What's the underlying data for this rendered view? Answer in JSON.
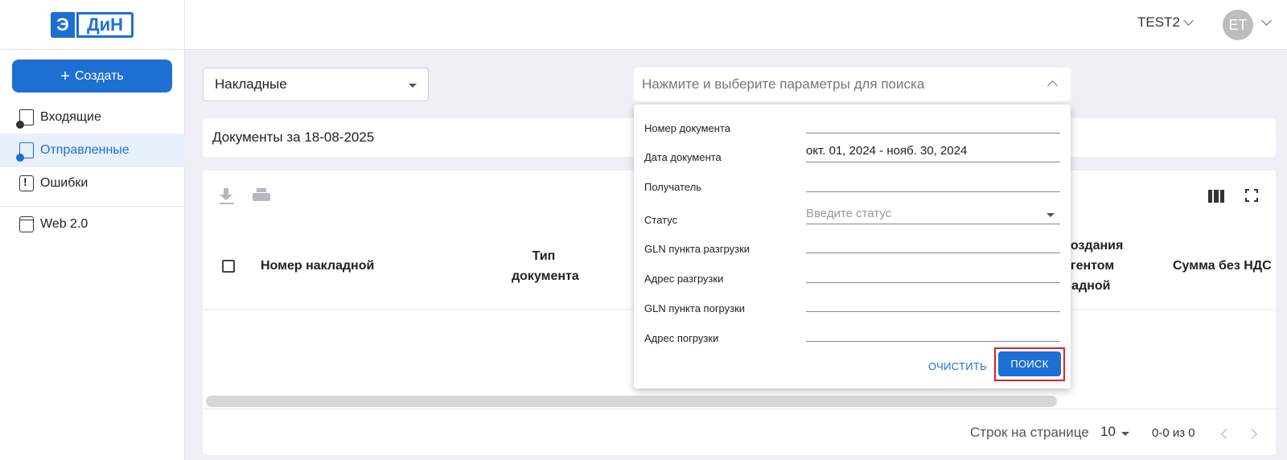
{
  "logo": {
    "left": "Э",
    "right": "ДиН"
  },
  "header": {
    "account": "TEST2",
    "avatar": "ET"
  },
  "sidebar": {
    "create_label": "Создать",
    "items": [
      {
        "label": "Входящие",
        "icon": "incoming-doc-icon"
      },
      {
        "label": "Отправленные",
        "icon": "sent-doc-icon",
        "active": true
      },
      {
        "label": "Ошибки",
        "icon": "clipboard-alert-icon"
      },
      {
        "label": "Web 2.0",
        "icon": "window-icon"
      }
    ]
  },
  "main": {
    "doc_type": "Накладные",
    "search_placeholder": "Нажмите и выберите параметры для поиска",
    "docs_title": "Документы за 18-08-2025",
    "table": {
      "columns": [
        "Номер накладной",
        "Тип документа",
        "Дата создания контрагентом накладной",
        "Сумма без НДС"
      ],
      "column_visible_parts": {
        "col1": "Номер накладной",
        "col2_line1": "Тип",
        "col2_line2": "документа",
        "col3_line1": "создания",
        "col3_line2": "агентом",
        "col3_line3": "ладной",
        "col4": "Сумма без НДС"
      }
    },
    "pagination": {
      "rows_label": "Строк на странице",
      "rows_value": "10",
      "range": "0-0 из 0"
    }
  },
  "filter": {
    "fields": [
      {
        "label": "Номер документа",
        "value": ""
      },
      {
        "label": "Дата документа",
        "value": "окт. 01, 2024 - нояб. 30, 2024"
      },
      {
        "label": "Получатель",
        "value": ""
      },
      {
        "label": "Статус",
        "placeholder": "Введите статус"
      },
      {
        "label": "GLN пункта разгрузки",
        "value": ""
      },
      {
        "label": "Адрес разгрузки",
        "value": ""
      },
      {
        "label": "GLN пункта погрузки",
        "value": ""
      },
      {
        "label": "Адрес погрузки",
        "value": ""
      }
    ],
    "clear_label": "ОЧИСТИТЬ",
    "search_label": "ПОИСК"
  },
  "colors": {
    "accent": "#1e6fd3",
    "highlight_frame": "#e02020"
  }
}
